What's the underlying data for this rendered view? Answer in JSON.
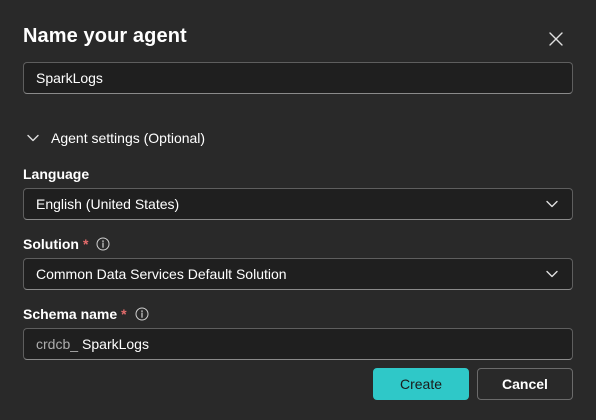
{
  "dialog": {
    "title": "Name your agent",
    "close_icon": "close-icon"
  },
  "name_field": {
    "value": "SparkLogs"
  },
  "agent_settings": {
    "toggle_label": "Agent settings (Optional)",
    "expanded": true
  },
  "language": {
    "label": "Language",
    "value": "English (United States)"
  },
  "solution": {
    "label": "Solution",
    "required_marker": "*",
    "value": "Common Data Services Default Solution"
  },
  "schema": {
    "label": "Schema name",
    "required_marker": "*",
    "prefix": "crdcb_",
    "value": "SparkLogs"
  },
  "buttons": {
    "create": "Create",
    "cancel": "Cancel"
  },
  "colors": {
    "background": "#292929",
    "accent": "#2fc8c8",
    "required": "#e36b6b"
  }
}
